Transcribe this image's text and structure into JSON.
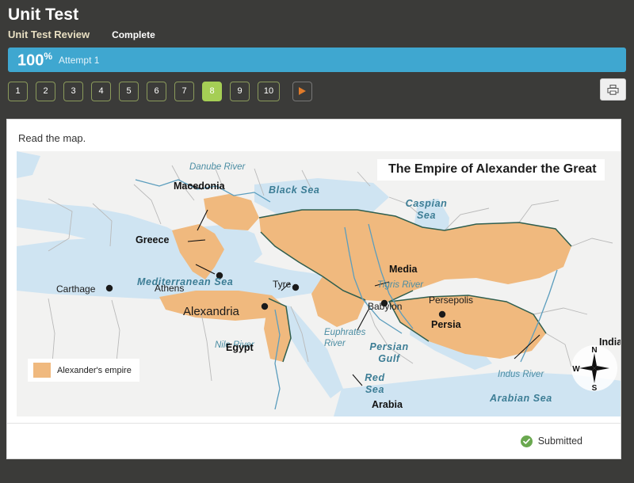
{
  "header": {
    "title": "Unit Test",
    "subtitle": "Unit Test Review",
    "status": "Complete"
  },
  "score": {
    "percent": "100",
    "percent_symbol": "%",
    "attempt": "Attempt 1",
    "bar_color": "#3fa7d0"
  },
  "nav": {
    "questions": [
      "1",
      "2",
      "3",
      "4",
      "5",
      "6",
      "7",
      "8",
      "9",
      "10"
    ],
    "active_question": "8",
    "active_color": "#a5ce55",
    "next_icon": "play-triangle-icon",
    "print_icon": "printer-icon"
  },
  "question": {
    "prompt": "Read the map."
  },
  "map": {
    "title": "The Empire of Alexander the Great",
    "legend": {
      "label": "Alexander's empire",
      "swatch_color": "#f0b97e"
    },
    "empire_color": "#f0b97e",
    "water_color": "#cfe4f2",
    "land_color": "#f2f2f1",
    "cities": [
      {
        "name": "Carthage"
      },
      {
        "name": "Athens"
      },
      {
        "name": "Tyre"
      },
      {
        "name": "Alexandria"
      },
      {
        "name": "Babylon"
      },
      {
        "name": "Persepolis"
      }
    ],
    "regions": [
      {
        "name": "Macedonia"
      },
      {
        "name": "Greece"
      },
      {
        "name": "Egypt"
      },
      {
        "name": "Media"
      },
      {
        "name": "Persia"
      },
      {
        "name": "Arabia"
      },
      {
        "name": "India"
      }
    ],
    "seas": [
      {
        "name": "Black Sea"
      },
      {
        "name": "Caspian Sea"
      },
      {
        "name": "Mediterranean Sea"
      },
      {
        "name": "Red Sea"
      },
      {
        "name": "Persian Gulf"
      },
      {
        "name": "Arabian Sea"
      }
    ],
    "rivers": [
      {
        "name": "Danube River"
      },
      {
        "name": "Nile River"
      },
      {
        "name": "Tigris River"
      },
      {
        "name": "Euphrates River"
      },
      {
        "name": "Indus River"
      }
    ],
    "compass": {
      "north": "N",
      "west": "W",
      "south": "S"
    }
  },
  "footer": {
    "submitted_label": "Submitted",
    "submitted_icon": "check-circle-icon",
    "submitted_color": "#6aa84f"
  }
}
